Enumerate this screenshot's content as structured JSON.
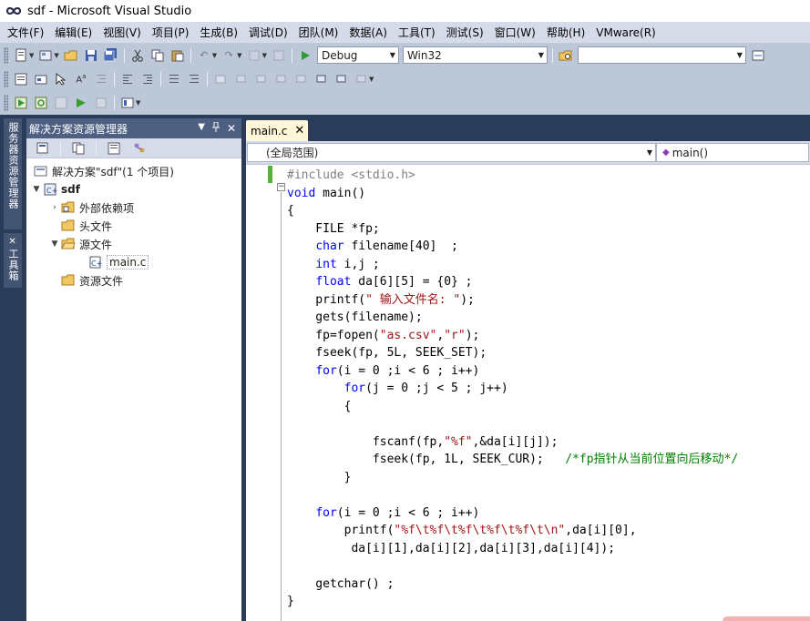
{
  "window": {
    "title": "sdf - Microsoft Visual Studio"
  },
  "menu": [
    "文件(F)",
    "编辑(E)",
    "视图(V)",
    "项目(P)",
    "生成(B)",
    "调试(D)",
    "团队(M)",
    "数据(A)",
    "工具(T)",
    "测试(S)",
    "窗口(W)",
    "帮助(H)",
    "VMware(R)"
  ],
  "toolbar": {
    "configuration": "Debug",
    "platform": "Win32",
    "find_value": ""
  },
  "side_tabs": {
    "server_explorer": "服务器资源管理器",
    "toolbox": "工具箱"
  },
  "solution_explorer": {
    "title": "解决方案资源管理器",
    "solution_label": "解决方案\"sdf\"(1 个项目)",
    "project": "sdf",
    "external_deps": "外部依赖项",
    "header_files": "头文件",
    "source_files": "源文件",
    "main_file": "main.c",
    "resource_files": "资源文件"
  },
  "editor": {
    "tab_label": "main.c",
    "scope": "(全局范围)",
    "member": "main()"
  },
  "code_lines": [
    [
      [
        "pp",
        "#include <stdio.h>"
      ]
    ],
    [
      [
        "kw",
        "void"
      ],
      [
        "tx",
        " main()"
      ]
    ],
    [
      [
        "tx",
        "{"
      ]
    ],
    [
      [
        "tx",
        "    FILE *fp;"
      ]
    ],
    [
      [
        "tx",
        "    "
      ],
      [
        "kw",
        "char"
      ],
      [
        "tx",
        " filename[40]  ;"
      ]
    ],
    [
      [
        "tx",
        "    "
      ],
      [
        "kw",
        "int"
      ],
      [
        "tx",
        " i,j ;"
      ]
    ],
    [
      [
        "tx",
        "    "
      ],
      [
        "kw",
        "float"
      ],
      [
        "tx",
        " da[6][5] = {0} ;"
      ]
    ],
    [
      [
        "tx",
        "    printf("
      ],
      [
        "str",
        "\" 输入文件名: \""
      ],
      [
        "tx",
        ");"
      ]
    ],
    [
      [
        "tx",
        "    gets(filename);"
      ]
    ],
    [
      [
        "tx",
        "    fp=fopen("
      ],
      [
        "str",
        "\"as.csv\""
      ],
      [
        "tx",
        ","
      ],
      [
        "str",
        "\"r\""
      ],
      [
        "tx",
        ");"
      ]
    ],
    [
      [
        "tx",
        "    fseek(fp, 5L, SEEK_SET);"
      ]
    ],
    [
      [
        "tx",
        "    "
      ],
      [
        "kw",
        "for"
      ],
      [
        "tx",
        "(i = 0 ;i < 6 ; i++)"
      ]
    ],
    [
      [
        "tx",
        "        "
      ],
      [
        "kw",
        "for"
      ],
      [
        "tx",
        "(j = 0 ;j < 5 ; j++)"
      ]
    ],
    [
      [
        "tx",
        "        {"
      ]
    ],
    [
      [
        "tx",
        ""
      ]
    ],
    [
      [
        "tx",
        "            fscanf(fp,"
      ],
      [
        "str",
        "\"%f\""
      ],
      [
        "tx",
        ",&da[i][j]);"
      ]
    ],
    [
      [
        "tx",
        "            fseek(fp, 1L, SEEK_CUR);   "
      ],
      [
        "cmt",
        "/*fp指针从当前位置向后移动*/"
      ]
    ],
    [
      [
        "tx",
        "        }"
      ]
    ],
    [
      [
        "tx",
        ""
      ]
    ],
    [
      [
        "tx",
        "    "
      ],
      [
        "kw",
        "for"
      ],
      [
        "tx",
        "(i = 0 ;i < 6 ; i++)"
      ]
    ],
    [
      [
        "tx",
        "        printf("
      ],
      [
        "str",
        "\"%f\\t%f\\t%f\\t%f\\t%f\\t\\n\""
      ],
      [
        "tx",
        ",da[i][0],"
      ]
    ],
    [
      [
        "tx",
        "         da[i][1],da[i][2],da[i][3],da[i][4]);"
      ]
    ],
    [
      [
        "tx",
        ""
      ]
    ],
    [
      [
        "tx",
        "    getchar() ;"
      ]
    ],
    [
      [
        "tx",
        "}"
      ]
    ]
  ]
}
